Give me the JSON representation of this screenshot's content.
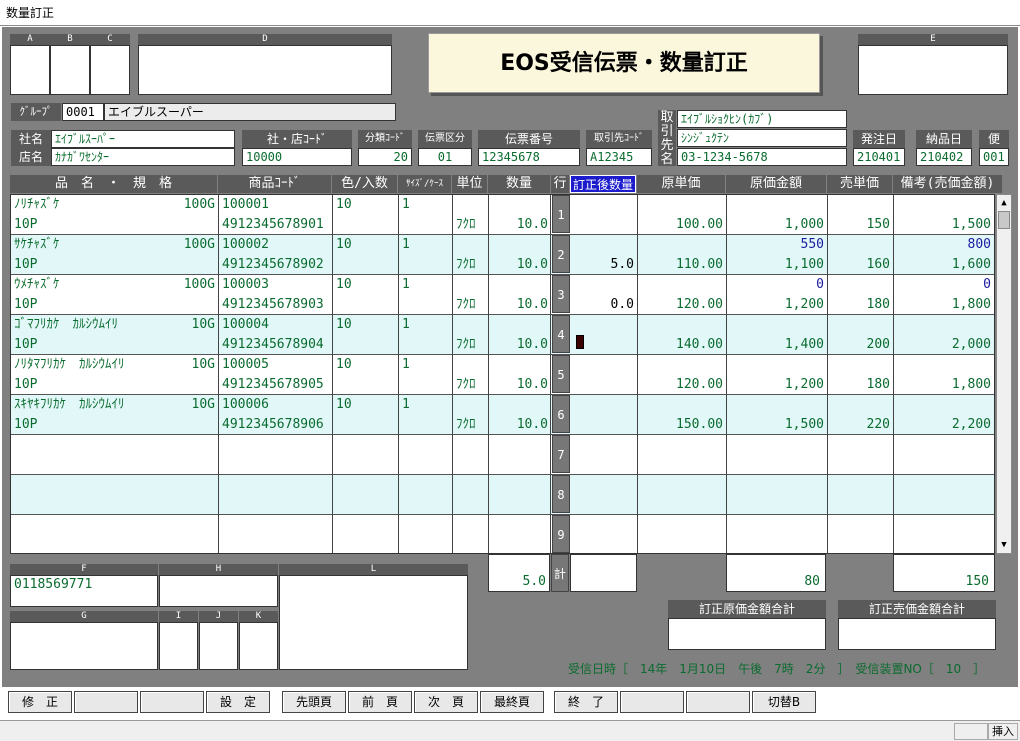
{
  "window": {
    "title": "数量訂正"
  },
  "header": {
    "title": "EOS受信伝票・数量訂正",
    "box_labels": {
      "a": "A",
      "b": "B",
      "c": "C",
      "d": "D",
      "e": "E"
    }
  },
  "group": {
    "label": "ｸﾞﾙｰﾌﾟ",
    "code": "0001",
    "name": "エイブルスーパー"
  },
  "company": {
    "label": "社名",
    "value": "ｴｲﾌﾞﾙｽｰﾊﾟｰ"
  },
  "store": {
    "label": "店名",
    "value": "ｶﾅｶﾞﾜｾﾝﾀｰ"
  },
  "company_store_code": {
    "label": "社・店ｺｰﾄﾞ",
    "value": "10000"
  },
  "category_code": {
    "label": "分類ｺｰﾄﾞ",
    "value": "20"
  },
  "slip_type": {
    "label": "伝票区分",
    "value": "01"
  },
  "slip_no": {
    "label": "伝票番号",
    "value": "12345678"
  },
  "supplier_code": {
    "label": "取引先ｺｰﾄﾞ",
    "value": "A12345"
  },
  "supplier": {
    "label": "取引先名",
    "name1": "ｴｲﾌﾞﾙｼｮｸﾋﾝ(ｶﾌﾞ)",
    "name2": "ｼﾝｼﾞｭｸﾃﾝ",
    "phone": "03-1234-5678"
  },
  "order_date": {
    "label": "発注日",
    "value": "210401"
  },
  "delivery_date": {
    "label": "納品日",
    "value": "210402"
  },
  "flight": {
    "label": "便",
    "value": "001"
  },
  "columns": [
    "品　名　・　規　格",
    "商品ｺｰﾄﾞ",
    "色/入数",
    "ｻｲｽﾞ/ｹｰｽ",
    "単位",
    "数量",
    "行",
    "訂正後数量",
    "原単価",
    "原価金額",
    "売単価",
    "備考(売価金額)"
  ],
  "rows": [
    {
      "no": "1",
      "name": "ﾉﾘﾁｬｽﾞｹ",
      "spec": "100G",
      "sub": "10P",
      "code1": "100001",
      "code2": "4912345678901",
      "iri": "10",
      "case": "1",
      "unit": "ﾌｸﾛ",
      "qty": "10.0",
      "corr": "",
      "price": "100.00",
      "cost_new": "",
      "cost": "1,000",
      "sell": "150",
      "remark_new": "",
      "remark": "1,500"
    },
    {
      "no": "2",
      "name": "ｻｹﾁｬｽﾞｹ",
      "spec": "100G",
      "sub": "10P",
      "code1": "100002",
      "code2": "4912345678902",
      "iri": "10",
      "case": "1",
      "unit": "ﾌｸﾛ",
      "qty": "10.0",
      "corr": "5.0",
      "price": "110.00",
      "cost_new": "550",
      "cost": "1,100",
      "sell": "160",
      "remark_new": "800",
      "remark": "1,600"
    },
    {
      "no": "3",
      "name": "ｳﾒﾁｬｽﾞｹ",
      "spec": "100G",
      "sub": "10P",
      "code1": "100003",
      "code2": "4912345678903",
      "iri": "10",
      "case": "1",
      "unit": "ﾌｸﾛ",
      "qty": "10.0",
      "corr": "0.0",
      "price": "120.00",
      "cost_new": "0",
      "cost": "1,200",
      "sell": "180",
      "remark_new": "0",
      "remark": "1,800"
    },
    {
      "no": "4",
      "name": "ｺﾞﾏﾌﾘｶｹ　ｶﾙｼｳﾑｲﾘ",
      "spec": "10G",
      "sub": "10P",
      "code1": "100004",
      "code2": "4912345678904",
      "iri": "10",
      "case": "1",
      "unit": "ﾌｸﾛ",
      "qty": "10.0",
      "corr": "",
      "price": "140.00",
      "cost_new": "",
      "cost": "1,400",
      "sell": "200",
      "remark_new": "",
      "remark": "2,000"
    },
    {
      "no": "5",
      "name": "ﾉﾘﾀﾏﾌﾘｶｹ　ｶﾙｼｳﾑｲﾘ",
      "spec": "10G",
      "sub": "10P",
      "code1": "100005",
      "code2": "4912345678905",
      "iri": "10",
      "case": "1",
      "unit": "ﾌｸﾛ",
      "qty": "10.0",
      "corr": "",
      "price": "120.00",
      "cost_new": "",
      "cost": "1,200",
      "sell": "180",
      "remark_new": "",
      "remark": "1,800"
    },
    {
      "no": "6",
      "name": "ｽｷﾔｷﾌﾘｶｹ　ｶﾙｼｳﾑｲﾘ",
      "spec": "10G",
      "sub": "10P",
      "code1": "100006",
      "code2": "4912345678906",
      "iri": "10",
      "case": "1",
      "unit": "ﾌｸﾛ",
      "qty": "10.0",
      "corr": "",
      "price": "150.00",
      "cost_new": "",
      "cost": "1,500",
      "sell": "220",
      "remark_new": "",
      "remark": "2,200"
    },
    {
      "no": "7",
      "name": "",
      "spec": "",
      "sub": "",
      "code1": "",
      "code2": "",
      "iri": "",
      "case": "",
      "unit": "",
      "qty": "",
      "corr": "",
      "price": "",
      "cost_new": "",
      "cost": "",
      "sell": "",
      "remark_new": "",
      "remark": ""
    },
    {
      "no": "8",
      "name": "",
      "spec": "",
      "sub": "",
      "code1": "",
      "code2": "",
      "iri": "",
      "case": "",
      "unit": "",
      "qty": "",
      "corr": "",
      "price": "",
      "cost_new": "",
      "cost": "",
      "sell": "",
      "remark_new": "",
      "remark": ""
    },
    {
      "no": "9",
      "name": "",
      "spec": "",
      "sub": "",
      "code1": "",
      "code2": "",
      "iri": "",
      "case": "",
      "unit": "",
      "qty": "",
      "corr": "",
      "price": "",
      "cost_new": "",
      "cost": "",
      "sell": "",
      "remark_new": "",
      "remark": ""
    }
  ],
  "totals": {
    "label": "計",
    "qty": "5.0",
    "cost": "80",
    "remark": "150"
  },
  "footer_boxes": {
    "f_label": "F",
    "f_value": "0118569771",
    "h_label": "H",
    "l_label": "L",
    "g_label": "G",
    "i_label": "I",
    "j_label": "J",
    "k_label": "K"
  },
  "corr_totals": {
    "cost_label": "訂正原価金額合計",
    "sell_label": "訂正売価金額合計"
  },
  "received": {
    "text": "受信日時［　14年　1月10日　午後　7時　2分　］　受信装置NO［　10　］"
  },
  "buttons": [
    "修　正",
    "",
    "",
    "設　定",
    "先頭頁",
    "前　頁",
    "次　頁",
    "最終頁",
    "終　了",
    "",
    "",
    "切替B"
  ],
  "status": {
    "mode": "挿入"
  },
  "colors": {
    "background": "#808080",
    "header_label": "#5a5a5a",
    "alt_row": "#e2f8f8",
    "green_text": "#0a6b2e",
    "blue_text": "#1a1aa0",
    "title_panel": "#fbf7dc"
  }
}
